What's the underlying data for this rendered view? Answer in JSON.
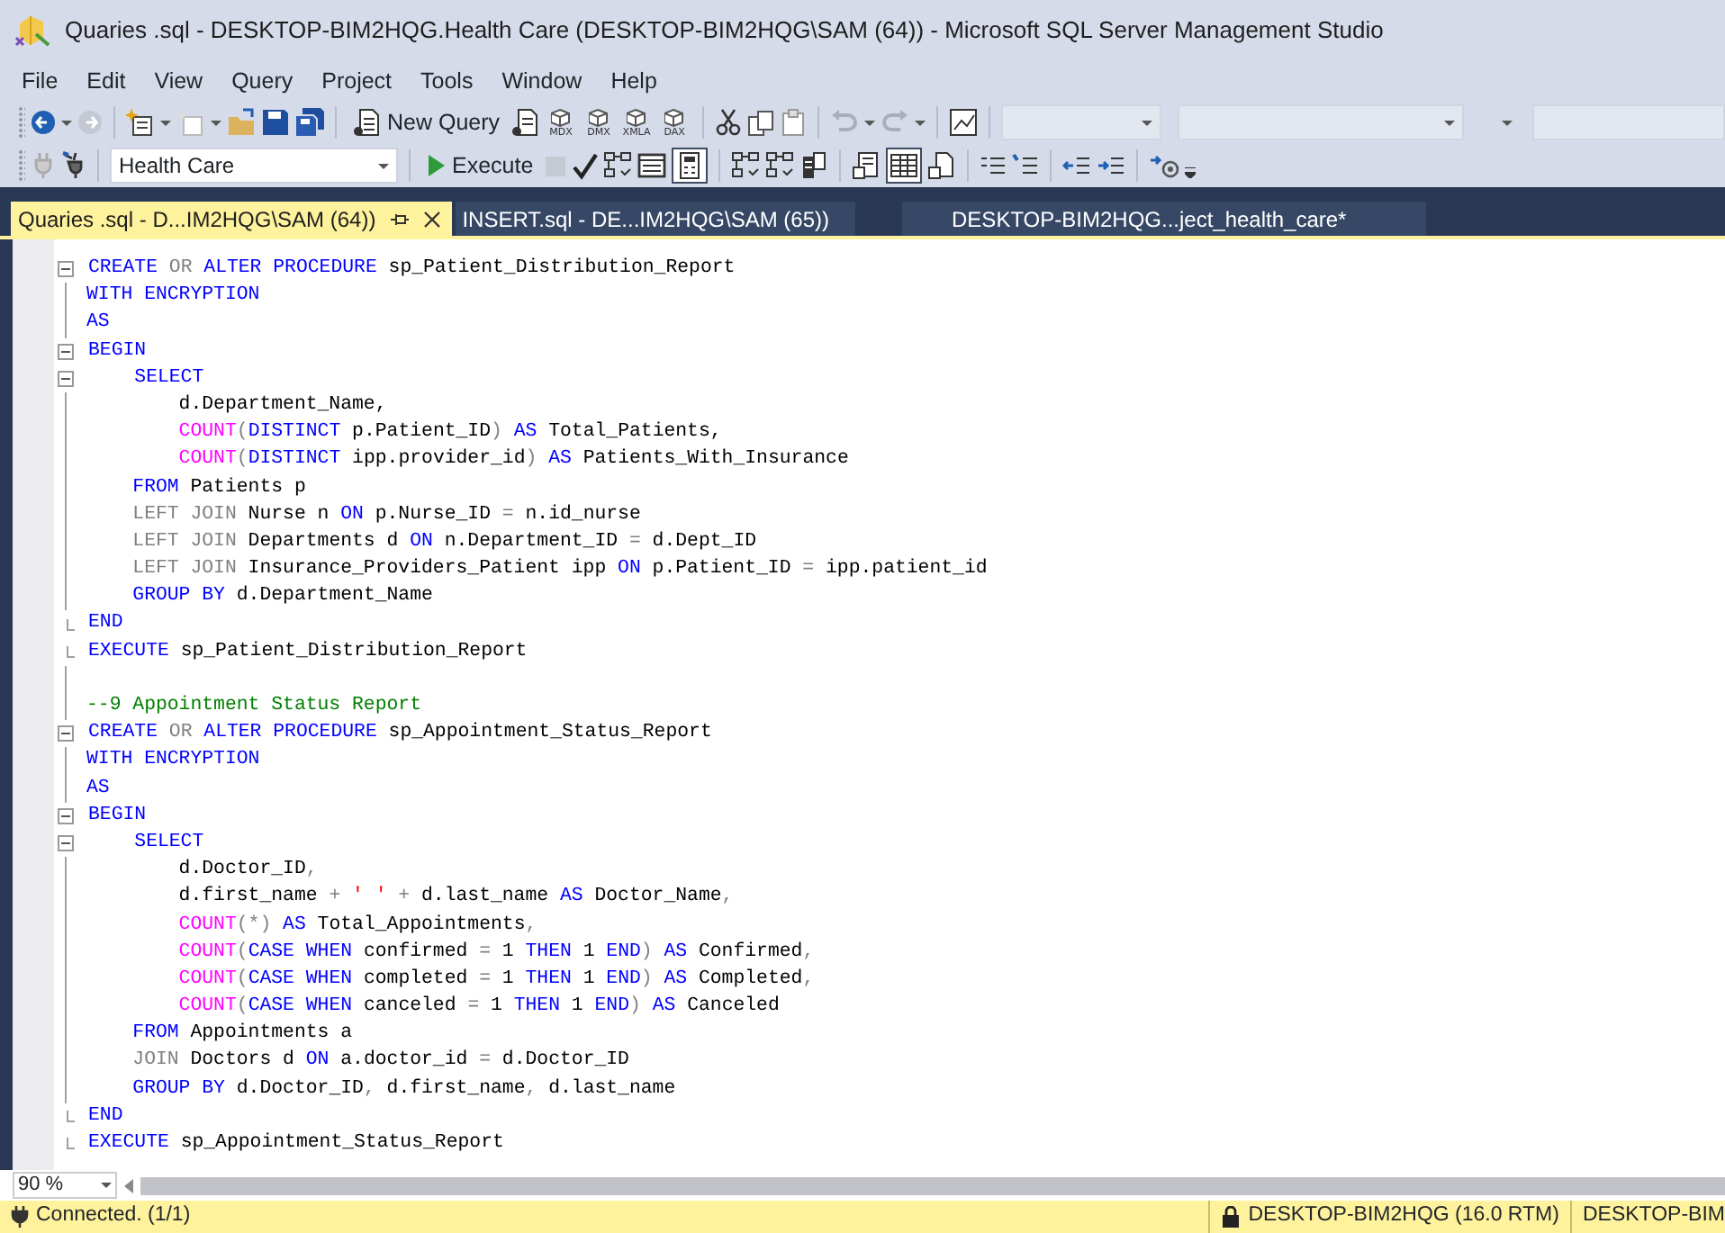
{
  "window": {
    "title": "Quaries .sql - DESKTOP-BIM2HQG.Health Care (DESKTOP-BIM2HQG\\SAM (64)) - Microsoft SQL Server Management Studio"
  },
  "menu": [
    "File",
    "Edit",
    "View",
    "Query",
    "Project",
    "Tools",
    "Window",
    "Help"
  ],
  "toolbar_1": {
    "forward_disabled": true,
    "add_item_disabled": true,
    "new_query": "New Query",
    "query_types": [
      "MDX",
      "DMX",
      "XMLA",
      "DAX"
    ],
    "undo_disabled": true,
    "redo_disabled": true
  },
  "toolbar_2": {
    "database": "Health Care",
    "execute": "Execute",
    "stop_disabled": true,
    "results_to_grid_pressed": true,
    "client_statistics_pressed": true
  },
  "tabs": [
    {
      "label": "Quaries .sql - D...IM2HQG\\SAM (64))",
      "selected": true
    },
    {
      "label": "INSERT.sql - DE...IM2HQG\\SAM (65))",
      "selected": false
    },
    {
      "label": "DESKTOP-BIM2HQG...ject_health_care*",
      "selected": false
    }
  ],
  "code": {
    "lines": [
      {
        "foldable": true,
        "block_end": false,
        "tokens": [
          {
            "kind": "keyword",
            "text": "CREATE "
          },
          {
            "kind": "operator",
            "text": "OR "
          },
          {
            "kind": "keyword",
            "text": "ALTER PROCEDURE "
          },
          {
            "kind": "plain",
            "text": "sp_Patient_Distribution_Report"
          }
        ]
      },
      {
        "foldable": false,
        "block_end": false,
        "tokens": [
          {
            "kind": "keyword",
            "text": "WITH ENCRYPTION"
          }
        ]
      },
      {
        "foldable": false,
        "block_end": false,
        "tokens": [
          {
            "kind": "keyword",
            "text": "AS"
          }
        ]
      },
      {
        "foldable": true,
        "block_end": false,
        "tokens": [
          {
            "kind": "keyword",
            "text": "BEGIN"
          }
        ]
      },
      {
        "foldable": true,
        "block_end": false,
        "tokens": [
          {
            "kind": "keyword",
            "text": "    SELECT"
          }
        ]
      },
      {
        "foldable": false,
        "block_end": false,
        "tokens": [
          {
            "kind": "plain",
            "text": "        d.Department_Name,"
          }
        ]
      },
      {
        "foldable": false,
        "block_end": false,
        "tokens": [
          {
            "kind": "function",
            "text": "        COUNT"
          },
          {
            "kind": "operator",
            "text": "("
          },
          {
            "kind": "keyword",
            "text": "DISTINCT "
          },
          {
            "kind": "plain",
            "text": "p.Patient_ID"
          },
          {
            "kind": "operator",
            "text": ") "
          },
          {
            "kind": "keyword",
            "text": "AS "
          },
          {
            "kind": "plain",
            "text": "Total_Patients,"
          }
        ]
      },
      {
        "foldable": false,
        "block_end": false,
        "tokens": [
          {
            "kind": "function",
            "text": "        COUNT"
          },
          {
            "kind": "operator",
            "text": "("
          },
          {
            "kind": "keyword",
            "text": "DISTINCT "
          },
          {
            "kind": "plain",
            "text": "ipp.provider_id"
          },
          {
            "kind": "operator",
            "text": ") "
          },
          {
            "kind": "keyword",
            "text": "AS "
          },
          {
            "kind": "plain",
            "text": "Patients_With_Insurance"
          }
        ]
      },
      {
        "foldable": false,
        "block_end": false,
        "tokens": [
          {
            "kind": "keyword",
            "text": "    FROM "
          },
          {
            "kind": "plain",
            "text": "Patients p"
          }
        ]
      },
      {
        "foldable": false,
        "block_end": false,
        "tokens": [
          {
            "kind": "operator",
            "text": "    LEFT JOIN "
          },
          {
            "kind": "plain",
            "text": "Nurse n "
          },
          {
            "kind": "keyword",
            "text": "ON "
          },
          {
            "kind": "plain",
            "text": "p.Nurse_ID "
          },
          {
            "kind": "operator",
            "text": "= "
          },
          {
            "kind": "plain",
            "text": "n.id_nurse"
          }
        ]
      },
      {
        "foldable": false,
        "block_end": false,
        "tokens": [
          {
            "kind": "operator",
            "text": "    LEFT JOIN "
          },
          {
            "kind": "plain",
            "text": "Departments d "
          },
          {
            "kind": "keyword",
            "text": "ON "
          },
          {
            "kind": "plain",
            "text": "n.Department_ID "
          },
          {
            "kind": "operator",
            "text": "= "
          },
          {
            "kind": "plain",
            "text": "d.Dept_ID"
          }
        ]
      },
      {
        "foldable": false,
        "block_end": false,
        "tokens": [
          {
            "kind": "operator",
            "text": "    LEFT JOIN "
          },
          {
            "kind": "plain",
            "text": "Insurance_Providers_Patient ipp "
          },
          {
            "kind": "keyword",
            "text": "ON "
          },
          {
            "kind": "plain",
            "text": "p.Patient_ID "
          },
          {
            "kind": "operator",
            "text": "= "
          },
          {
            "kind": "plain",
            "text": "ipp.patient_id"
          }
        ]
      },
      {
        "foldable": false,
        "block_end": false,
        "tokens": [
          {
            "kind": "keyword",
            "text": "    GROUP BY "
          },
          {
            "kind": "plain",
            "text": "d.Department_Name"
          }
        ]
      },
      {
        "foldable": false,
        "block_end": true,
        "tokens": [
          {
            "kind": "keyword",
            "text": "END"
          }
        ]
      },
      {
        "foldable": false,
        "block_end": true,
        "tokens": [
          {
            "kind": "keyword",
            "text": "EXECUTE "
          },
          {
            "kind": "plain",
            "text": "sp_Patient_Distribution_Report"
          }
        ]
      },
      {
        "foldable": false,
        "block_end": false
      },
      {
        "foldable": false,
        "block_end": false,
        "tokens": [
          {
            "kind": "comment",
            "text": "--9 Appointment Status Report"
          }
        ]
      },
      {
        "foldable": true,
        "block_end": false,
        "tokens": [
          {
            "kind": "keyword",
            "text": "CREATE "
          },
          {
            "kind": "operator",
            "text": "OR "
          },
          {
            "kind": "keyword",
            "text": "ALTER PROCEDURE "
          },
          {
            "kind": "plain",
            "text": "sp_Appointment_Status_Report"
          }
        ]
      },
      {
        "foldable": false,
        "block_end": false,
        "tokens": [
          {
            "kind": "keyword",
            "text": "WITH ENCRYPTION"
          }
        ]
      },
      {
        "foldable": false,
        "block_end": false,
        "tokens": [
          {
            "kind": "keyword",
            "text": "AS"
          }
        ]
      },
      {
        "foldable": true,
        "block_end": false,
        "tokens": [
          {
            "kind": "keyword",
            "text": "BEGIN"
          }
        ]
      },
      {
        "foldable": true,
        "block_end": false,
        "tokens": [
          {
            "kind": "keyword",
            "text": "    SELECT"
          }
        ]
      },
      {
        "foldable": false,
        "block_end": false,
        "tokens": [
          {
            "kind": "plain",
            "text": "        d.Doctor_ID"
          },
          {
            "kind": "operator",
            "text": ","
          }
        ]
      },
      {
        "foldable": false,
        "block_end": false,
        "tokens": [
          {
            "kind": "plain",
            "text": "        d.first_name "
          },
          {
            "kind": "operator",
            "text": "+ "
          },
          {
            "kind": "string",
            "text": "' ' "
          },
          {
            "kind": "operator",
            "text": "+ "
          },
          {
            "kind": "plain",
            "text": "d.last_name "
          },
          {
            "kind": "keyword",
            "text": "AS "
          },
          {
            "kind": "plain",
            "text": "Doctor_Name"
          },
          {
            "kind": "operator",
            "text": ","
          }
        ]
      },
      {
        "foldable": false,
        "block_end": false,
        "tokens": [
          {
            "kind": "function",
            "text": "        COUNT"
          },
          {
            "kind": "operator",
            "text": "(*) "
          },
          {
            "kind": "keyword",
            "text": "AS "
          },
          {
            "kind": "plain",
            "text": "Total_Appointments"
          },
          {
            "kind": "operator",
            "text": ","
          }
        ]
      },
      {
        "foldable": false,
        "block_end": false,
        "tokens": [
          {
            "kind": "function",
            "text": "        COUNT"
          },
          {
            "kind": "operator",
            "text": "("
          },
          {
            "kind": "keyword",
            "text": "CASE WHEN "
          },
          {
            "kind": "plain",
            "text": "confirmed "
          },
          {
            "kind": "operator",
            "text": "= "
          },
          {
            "kind": "plain",
            "text": "1 "
          },
          {
            "kind": "keyword",
            "text": "THEN "
          },
          {
            "kind": "plain",
            "text": "1 "
          },
          {
            "kind": "keyword",
            "text": "END"
          },
          {
            "kind": "operator",
            "text": ") "
          },
          {
            "kind": "keyword",
            "text": "AS "
          },
          {
            "kind": "plain",
            "text": "Confirmed"
          },
          {
            "kind": "operator",
            "text": ","
          }
        ]
      },
      {
        "foldable": false,
        "block_end": false,
        "tokens": [
          {
            "kind": "function",
            "text": "        COUNT"
          },
          {
            "kind": "operator",
            "text": "("
          },
          {
            "kind": "keyword",
            "text": "CASE WHEN "
          },
          {
            "kind": "plain",
            "text": "completed "
          },
          {
            "kind": "operator",
            "text": "= "
          },
          {
            "kind": "plain",
            "text": "1 "
          },
          {
            "kind": "keyword",
            "text": "THEN "
          },
          {
            "kind": "plain",
            "text": "1 "
          },
          {
            "kind": "keyword",
            "text": "END"
          },
          {
            "kind": "operator",
            "text": ") "
          },
          {
            "kind": "keyword",
            "text": "AS "
          },
          {
            "kind": "plain",
            "text": "Completed"
          },
          {
            "kind": "operator",
            "text": ","
          }
        ]
      },
      {
        "foldable": false,
        "block_end": false,
        "tokens": [
          {
            "kind": "function",
            "text": "        COUNT"
          },
          {
            "kind": "operator",
            "text": "("
          },
          {
            "kind": "keyword",
            "text": "CASE WHEN "
          },
          {
            "kind": "plain",
            "text": "canceled "
          },
          {
            "kind": "operator",
            "text": "= "
          },
          {
            "kind": "plain",
            "text": "1 "
          },
          {
            "kind": "keyword",
            "text": "THEN "
          },
          {
            "kind": "plain",
            "text": "1 "
          },
          {
            "kind": "keyword",
            "text": "END"
          },
          {
            "kind": "operator",
            "text": ") "
          },
          {
            "kind": "keyword",
            "text": "AS "
          },
          {
            "kind": "plain",
            "text": "Canceled"
          }
        ]
      },
      {
        "foldable": false,
        "block_end": false,
        "tokens": [
          {
            "kind": "keyword",
            "text": "    FROM "
          },
          {
            "kind": "plain",
            "text": "Appointments a"
          }
        ]
      },
      {
        "foldable": false,
        "block_end": false,
        "tokens": [
          {
            "kind": "operator",
            "text": "    JOIN "
          },
          {
            "kind": "plain",
            "text": "Doctors d "
          },
          {
            "kind": "keyword",
            "text": "ON "
          },
          {
            "kind": "plain",
            "text": "a.doctor_id "
          },
          {
            "kind": "operator",
            "text": "= "
          },
          {
            "kind": "plain",
            "text": "d.Doctor_ID"
          }
        ]
      },
      {
        "foldable": false,
        "block_end": false,
        "tokens": [
          {
            "kind": "keyword",
            "text": "    GROUP BY "
          },
          {
            "kind": "plain",
            "text": "d.Doctor_ID"
          },
          {
            "kind": "operator",
            "text": ", "
          },
          {
            "kind": "plain",
            "text": "d.first_name"
          },
          {
            "kind": "operator",
            "text": ", "
          },
          {
            "kind": "plain",
            "text": "d.last_name"
          }
        ]
      },
      {
        "foldable": false,
        "block_end": true,
        "tokens": [
          {
            "kind": "keyword",
            "text": "END"
          }
        ]
      },
      {
        "foldable": false,
        "block_end": true,
        "tokens": [
          {
            "kind": "keyword",
            "text": "EXECUTE "
          },
          {
            "kind": "plain",
            "text": "sp_Appointment_Status_Report"
          }
        ]
      }
    ]
  },
  "zoom": "90 %",
  "status_bar": {
    "connection": "Connected. (1/1)",
    "server": "DESKTOP-BIM2HQG (16.0 RTM)",
    "login": "DESKTOP-BIM"
  }
}
